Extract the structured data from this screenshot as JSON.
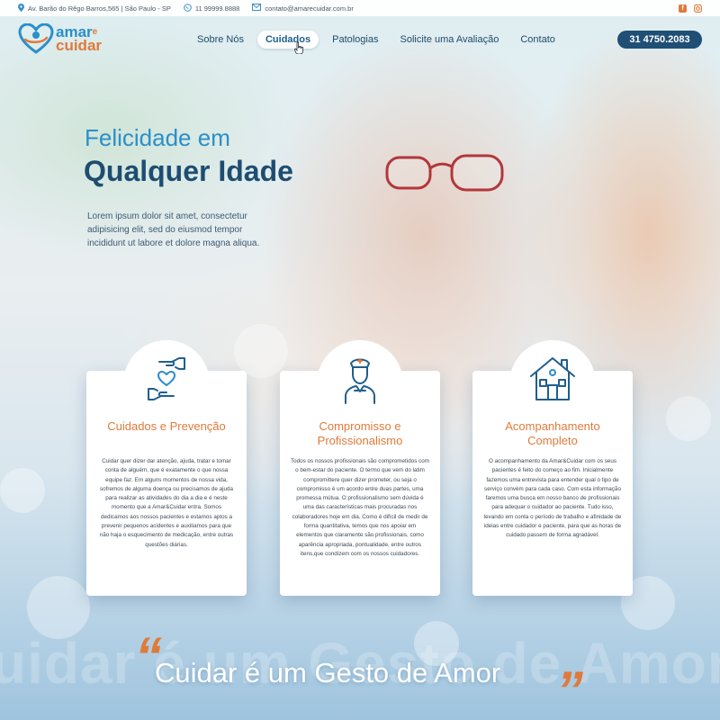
{
  "topbar": {
    "address": "Av. Barão do Rêgo Barros,565 | São Paulo - SP",
    "whatsapp": "11 99999.8888",
    "email": "contato@amarecuidar.com.br"
  },
  "logo": {
    "line1": "amar",
    "connector": "e",
    "line2": "cuidar"
  },
  "nav": [
    {
      "label": "Sobre Nós"
    },
    {
      "label": "Cuidados",
      "active": true
    },
    {
      "label": "Patologias"
    },
    {
      "label": "Solicite uma Avaliação"
    },
    {
      "label": "Contato"
    }
  ],
  "phone": "31 4750.2083",
  "hero": {
    "subtitle": "Felicidade em",
    "title": "Qualquer Idade",
    "text": "Lorem ipsum dolor sit amet, consectetur adipisicing elit, sed do eiusmod tempor incididunt ut labore et dolore magna aliqua."
  },
  "cards": [
    {
      "icon": "caring-hands-heart-icon",
      "title": "Cuidados e Prevenção",
      "text": "Cuidar quer dizer dar atenção, ajuda, tratar e tomar conta de alguém, que é exatamente o que nossa equipe faz. Em alguns momentos de nossa vida, sofremos de alguma doença ou precisamos de ajuda para realizar as atividades do dia a dia e é neste momento que a Amar&Cuidar entra. Somos dedicamos aos nossos pacientes e estamos aptos a prevenir pequenos acidentes e auxiliamos para que não haja o esquecimento de medicação, entre outras questões diárias."
    },
    {
      "icon": "nurse-icon",
      "title": "Compromisso e Profissionalismo",
      "text": "Todos os nossos profissionais são comprometidos com o bem-estar do paciente. O termo que vem do latim compromittere quer dizer prometer, ou seja o compromisso é um acordo entre duas partes, uma promessa mútua. O profissionalismo sem dúvida é uma das características mais procuradas nos colaboradores hoje em dia. Como é difícil de medir de forma quantitativa, temos que nos apoiar em elementos que claramente são profissionais, como aparência apropriada, pontualidade, entre outros itens,que condizem com os nossos cuidadores."
    },
    {
      "icon": "house-icon",
      "title": "Acompanhamento Completo",
      "text": "O acompanhamento da Amar&Cuidar com os seus pacientes é feito do começo ao fim. Inicialmente fazemos uma entrevista para entender qual o tipo de serviço convém para cada caso. Com esta informação faremos uma busca em nosso banco de profissionais para adequar o cuidador ao paciente. Tudo isso, levando em conta o período de trabalho e afinidade de ideias entre cuidador e paciente, para que as horas de cuidado passem de forma agradável."
    }
  ],
  "bottom": {
    "background_words": "uidar é um Gesto de Amor",
    "slogan": "Cuidar é um Gesto de Amor"
  },
  "colors": {
    "primary": "#2b8fc9",
    "dark": "#1e4d72",
    "accent": "#e07a3a"
  }
}
